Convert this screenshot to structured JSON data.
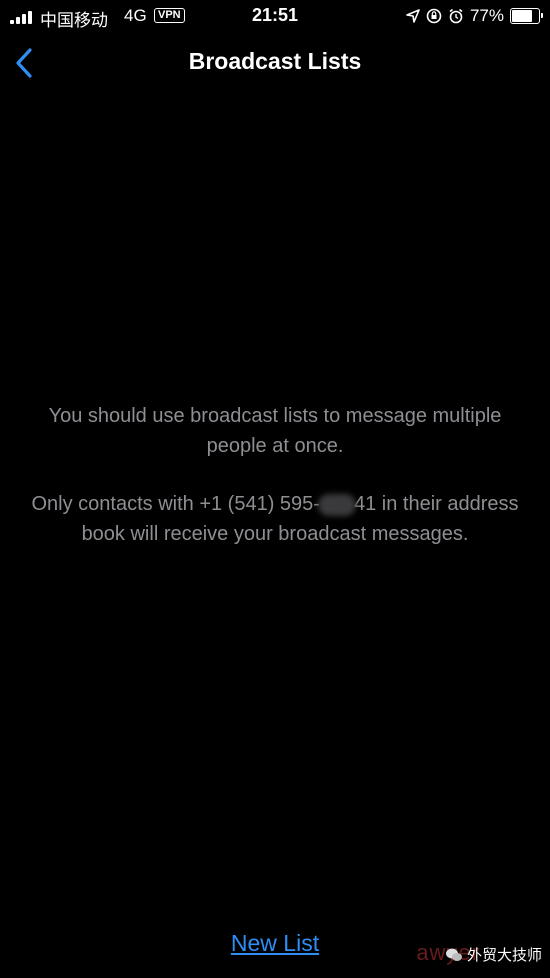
{
  "status_bar": {
    "carrier": "中国移动",
    "network": "4G",
    "vpn": "VPN",
    "time": "21:51",
    "battery": "77%",
    "battery_level": 0.77
  },
  "nav": {
    "title": "Broadcast Lists"
  },
  "body": {
    "message_1": "You should use broadcast lists to message multiple people at once.",
    "message_2_before": "Only contacts with +1 (541) 595-",
    "message_2_after": "41 in their address book will receive your broadcast messages."
  },
  "footer": {
    "new_list_label": "New List"
  },
  "watermark": {
    "text": "外贸大技师",
    "background_text": "awyer"
  }
}
